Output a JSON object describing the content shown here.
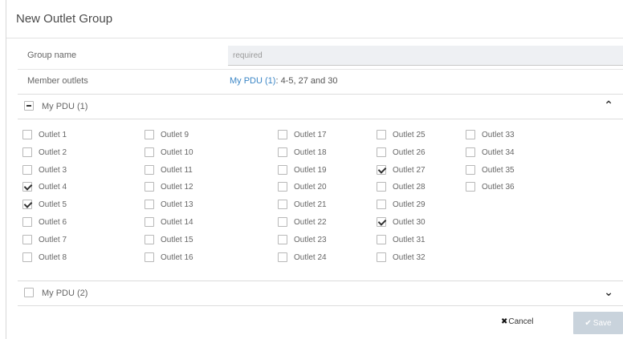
{
  "dialog": {
    "title": "New Outlet Group"
  },
  "form": {
    "group_name_label": "Group name",
    "group_name_placeholder": "required",
    "member_outlets_label": "Member outlets",
    "member_outlets_pdu": "My PDU (1)",
    "member_outlets_list": ": 4-5, 27 and 30"
  },
  "pdus": [
    {
      "name": "My PDU (1)",
      "state": "indeterminate",
      "expanded": true,
      "chevron": "chevron-up-icon",
      "outlets": [
        {
          "label": "Outlet 1",
          "checked": false
        },
        {
          "label": "Outlet 2",
          "checked": false
        },
        {
          "label": "Outlet 3",
          "checked": false
        },
        {
          "label": "Outlet 4",
          "checked": true
        },
        {
          "label": "Outlet 5",
          "checked": true
        },
        {
          "label": "Outlet 6",
          "checked": false
        },
        {
          "label": "Outlet 7",
          "checked": false
        },
        {
          "label": "Outlet 8",
          "checked": false
        },
        {
          "label": "Outlet 9",
          "checked": false
        },
        {
          "label": "Outlet 10",
          "checked": false
        },
        {
          "label": "Outlet 11",
          "checked": false
        },
        {
          "label": "Outlet 12",
          "checked": false
        },
        {
          "label": "Outlet 13",
          "checked": false
        },
        {
          "label": "Outlet 14",
          "checked": false
        },
        {
          "label": "Outlet 15",
          "checked": false
        },
        {
          "label": "Outlet 16",
          "checked": false
        },
        {
          "label": "Outlet 17",
          "checked": false
        },
        {
          "label": "Outlet 18",
          "checked": false
        },
        {
          "label": "Outlet 19",
          "checked": false
        },
        {
          "label": "Outlet 20",
          "checked": false
        },
        {
          "label": "Outlet 21",
          "checked": false
        },
        {
          "label": "Outlet 22",
          "checked": false
        },
        {
          "label": "Outlet 23",
          "checked": false
        },
        {
          "label": "Outlet 24",
          "checked": false
        },
        {
          "label": "Outlet 25",
          "checked": false
        },
        {
          "label": "Outlet 26",
          "checked": false
        },
        {
          "label": "Outlet 27",
          "checked": true
        },
        {
          "label": "Outlet 28",
          "checked": false
        },
        {
          "label": "Outlet 29",
          "checked": false
        },
        {
          "label": "Outlet 30",
          "checked": true
        },
        {
          "label": "Outlet 31",
          "checked": false
        },
        {
          "label": "Outlet 32",
          "checked": false
        },
        {
          "label": "Outlet 33",
          "checked": false
        },
        {
          "label": "Outlet 34",
          "checked": false
        },
        {
          "label": "Outlet 35",
          "checked": false
        },
        {
          "label": "Outlet 36",
          "checked": false
        }
      ]
    },
    {
      "name": "My PDU (2)",
      "state": "unchecked",
      "expanded": false,
      "chevron": "chevron-down-icon"
    }
  ],
  "actions": {
    "cancel_icon": "close-icon",
    "cancel_label": "Cancel",
    "save_icon": "check-icon",
    "save_label": "Save",
    "save_enabled": false
  },
  "colors": {
    "link": "#3b86c6",
    "save_disabled_bg": "#c9d3dc"
  }
}
